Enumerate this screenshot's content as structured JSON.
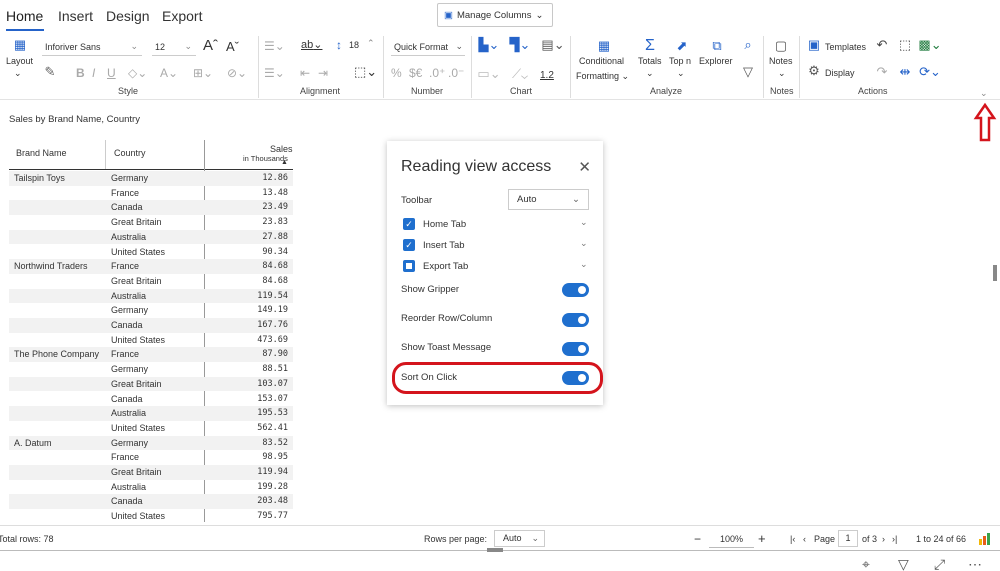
{
  "tabs": [
    "Home",
    "Insert",
    "Design",
    "Export"
  ],
  "manage_columns": "Manage Columns",
  "ribbon": {
    "layout": "Layout",
    "font_name": "Inforiver Sans",
    "font_size": "12",
    "line_height": "18",
    "ab_label": "ab",
    "quick_format": "Quick Format",
    "num_pct": "%",
    "num_currency": "$€",
    "num_inc": ".0⁺",
    "num_dec": ".0⁻",
    "scale_value": "1.2",
    "conditional": "Conditional",
    "formatting": "Formatting",
    "totals": "Totals",
    "topn": "Top n",
    "explorer": "Explorer",
    "notes": "Notes",
    "templates": "Templates",
    "display": "Display",
    "groups": [
      "Style",
      "Alignment",
      "Number",
      "Chart",
      "Analyze",
      "Notes",
      "Actions"
    ]
  },
  "caption": "Sales by Brand Name, Country",
  "table": {
    "col_brand": "Brand Name",
    "col_country": "Country",
    "col_sales": "Sales",
    "col_sales_unit": "in Thousands",
    "rows": [
      {
        "brand": "Tailspin Toys",
        "country": "Germany",
        "sales": "12.86"
      },
      {
        "brand": "",
        "country": "France",
        "sales": "13.48"
      },
      {
        "brand": "",
        "country": "Canada",
        "sales": "23.49"
      },
      {
        "brand": "",
        "country": "Great Britain",
        "sales": "23.83"
      },
      {
        "brand": "",
        "country": "Australia",
        "sales": "27.88"
      },
      {
        "brand": "",
        "country": "United States",
        "sales": "90.34"
      },
      {
        "brand": "Northwind Traders",
        "country": "France",
        "sales": "84.68"
      },
      {
        "brand": "",
        "country": "Great Britain",
        "sales": "84.68"
      },
      {
        "brand": "",
        "country": "Australia",
        "sales": "119.54"
      },
      {
        "brand": "",
        "country": "Germany",
        "sales": "149.19"
      },
      {
        "brand": "",
        "country": "Canada",
        "sales": "167.76"
      },
      {
        "brand": "",
        "country": "United States",
        "sales": "473.69"
      },
      {
        "brand": "The Phone Company",
        "country": "France",
        "sales": "87.90"
      },
      {
        "brand": "",
        "country": "Germany",
        "sales": "88.51"
      },
      {
        "brand": "",
        "country": "Great Britain",
        "sales": "103.07"
      },
      {
        "brand": "",
        "country": "Canada",
        "sales": "153.07"
      },
      {
        "brand": "",
        "country": "Australia",
        "sales": "195.53"
      },
      {
        "brand": "",
        "country": "United States",
        "sales": "562.41"
      },
      {
        "brand": "A. Datum",
        "country": "Germany",
        "sales": "83.52"
      },
      {
        "brand": "",
        "country": "France",
        "sales": "98.95"
      },
      {
        "brand": "",
        "country": "Great Britain",
        "sales": "119.94"
      },
      {
        "brand": "",
        "country": "Australia",
        "sales": "199.28"
      },
      {
        "brand": "",
        "country": "Canada",
        "sales": "203.48"
      },
      {
        "brand": "",
        "country": "United States",
        "sales": "795.77"
      }
    ]
  },
  "panel": {
    "title": "Reading view access",
    "toolbar_label": "Toolbar",
    "toolbar_value": "Auto",
    "home_tab": "Home Tab",
    "insert_tab": "Insert Tab",
    "export_tab": "Export Tab",
    "show_gripper": "Show Gripper",
    "reorder": "Reorder Row/Column",
    "toast": "Show Toast Message",
    "sort_on_click": "Sort On Click"
  },
  "footer": {
    "total_rows": "Total rows: 78",
    "rows_per_page_label": "Rows per page:",
    "rows_per_page_value": "Auto",
    "zoom": "100%",
    "page_label": "Page",
    "page_value": "1",
    "of_pages": "of 3",
    "range": "1 to 24 of 66"
  },
  "colors": {
    "accent": "#1f6fce",
    "highlight": "#d4141c"
  }
}
